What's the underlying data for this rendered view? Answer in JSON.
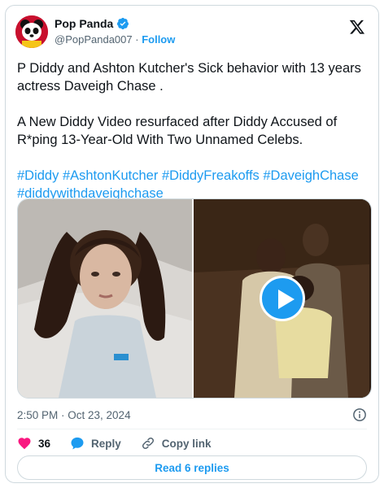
{
  "author": {
    "name": "Pop Panda",
    "handle": "@PopPanda007",
    "separator": "·",
    "follow_label": "Follow"
  },
  "tweet": {
    "line1": "P Diddy and Ashton Kutcher's Sick behavior with 13 years actress Daveigh Chase .",
    "line2": "A  New Diddy Video resurfaced after Diddy Accused of R*ping 13-Year-Old With Two Unnamed Celebs.",
    "hashtags": "#Diddy #AshtonKutcher #DiddyFreakoffs #DaveighChase #diddywithdaveighchase"
  },
  "timestamp": "2:50 PM · Oct 23, 2024",
  "actions": {
    "like_count": "36",
    "reply_label": "Reply",
    "copy_link_label": "Copy link"
  },
  "read_replies_label": "Read 6 replies",
  "colors": {
    "accent": "#1d9bf0",
    "like": "#f91880",
    "text": "#0f1419",
    "muted": "#536471"
  },
  "icons": [
    "verified-badge-icon",
    "x-logo-icon",
    "play-icon",
    "info-icon",
    "heart-icon",
    "reply-bubble-icon",
    "link-icon"
  ]
}
